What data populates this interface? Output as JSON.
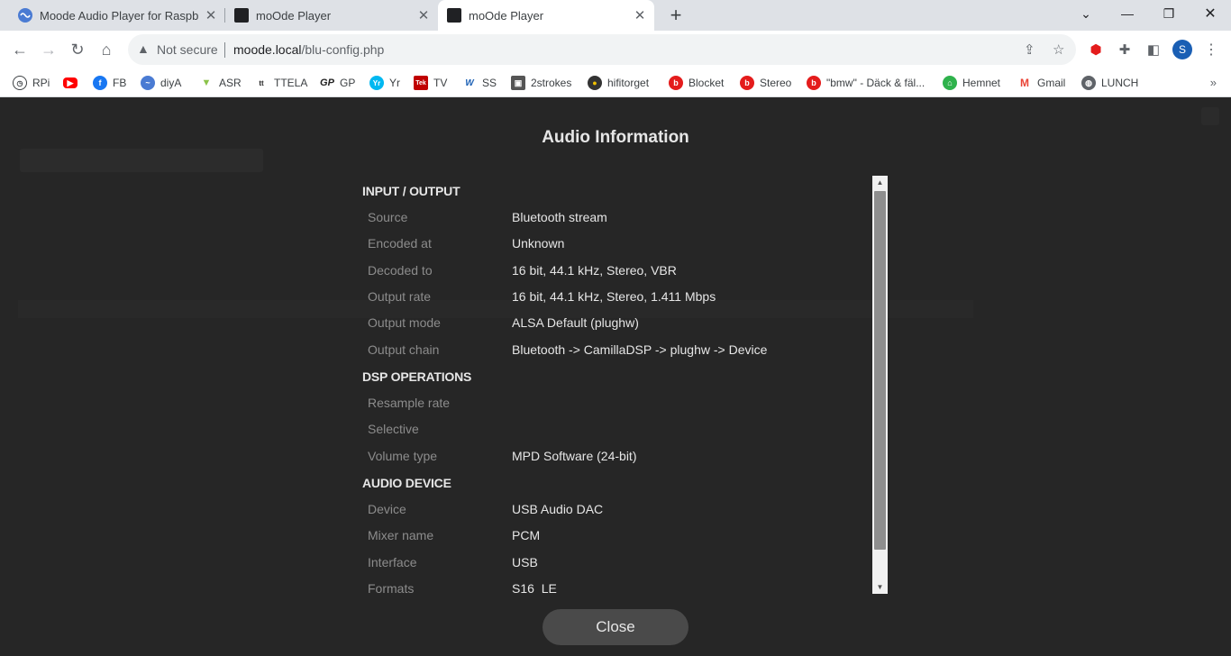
{
  "browser": {
    "tabs": [
      {
        "title": "Moode Audio Player for Raspberry Pi",
        "active": false
      },
      {
        "title": "moOde Player",
        "active": false
      },
      {
        "title": "moOde Player",
        "active": true
      }
    ],
    "address": {
      "security_label": "Not secure",
      "host": "moode.local",
      "path": "/blu-config.php"
    },
    "profile_initial": "S",
    "bookmarks": [
      {
        "label": "RPi",
        "icon": "clock-icon",
        "color": "#3c4043"
      },
      {
        "label": "",
        "icon": "youtube-icon",
        "color": "#ff0000"
      },
      {
        "label": "FB",
        "icon": "facebook-icon",
        "color": "#1877f2"
      },
      {
        "label": "diyA",
        "icon": "diya-icon",
        "color": "#4a7bd3"
      },
      {
        "label": "ASR",
        "icon": "asr-icon",
        "color": "#8bc34a"
      },
      {
        "label": "TTELA",
        "icon": "ttela-icon",
        "color": "#222222"
      },
      {
        "label": "GP",
        "icon": "gp-icon",
        "color": "#222222"
      },
      {
        "label": "Yr",
        "icon": "yr-icon",
        "color": "#00b8f1"
      },
      {
        "label": "TV",
        "icon": "tek-icon",
        "color": "#c00000"
      },
      {
        "label": "SS",
        "icon": "sweclockers-icon",
        "color": "#1a5fb4"
      },
      {
        "label": "2strokes",
        "icon": "2strokes-icon",
        "color": "#555555"
      },
      {
        "label": "hifitorget",
        "icon": "hifitorget-icon",
        "color": "#333333"
      },
      {
        "label": "Blocket",
        "icon": "blocket-icon",
        "color": "#e41c1c"
      },
      {
        "label": "Stereo",
        "icon": "blocket-icon",
        "color": "#e41c1c"
      },
      {
        "label": "\"bmw\" - Däck & fäl...",
        "icon": "blocket-icon",
        "color": "#e41c1c"
      },
      {
        "label": "Hemnet",
        "icon": "hemnet-icon",
        "color": "#2fb24c"
      },
      {
        "label": "Gmail",
        "icon": "gmail-icon",
        "color": "#ea4335"
      },
      {
        "label": "LUNCH",
        "icon": "globe-icon",
        "color": "#5f6368"
      }
    ],
    "bookmarks_more": "»"
  },
  "modal": {
    "title": "Audio Information",
    "close_label": "Close",
    "sections": [
      {
        "heading": "INPUT / OUTPUT",
        "rows": [
          {
            "label": "Source",
            "value": "Bluetooth stream"
          },
          {
            "label": "Encoded at",
            "value": "Unknown"
          },
          {
            "label": "Decoded to",
            "value": "16 bit, 44.1 kHz, Stereo, VBR"
          },
          {
            "label": "Output rate",
            "value": "16 bit, 44.1 kHz, Stereo, 1.411 Mbps"
          },
          {
            "label": "Output mode",
            "value": "ALSA Default (plughw)"
          },
          {
            "label": "Output chain",
            "value": "Bluetooth -> CamillaDSP -> plughw -> Device"
          }
        ]
      },
      {
        "heading": "DSP OPERATIONS",
        "rows": [
          {
            "label": "Resample rate",
            "value": ""
          },
          {
            "label": "Selective",
            "value": ""
          },
          {
            "label": "Volume type",
            "value": "MPD Software (24-bit)"
          }
        ]
      },
      {
        "heading": "AUDIO DEVICE",
        "rows": [
          {
            "label": "Device",
            "value": "USB Audio DAC"
          },
          {
            "label": "Mixer name",
            "value": "PCM"
          },
          {
            "label": "Interface",
            "value": "USB"
          },
          {
            "label": "Formats",
            "value": "S16_LE"
          }
        ]
      }
    ]
  }
}
